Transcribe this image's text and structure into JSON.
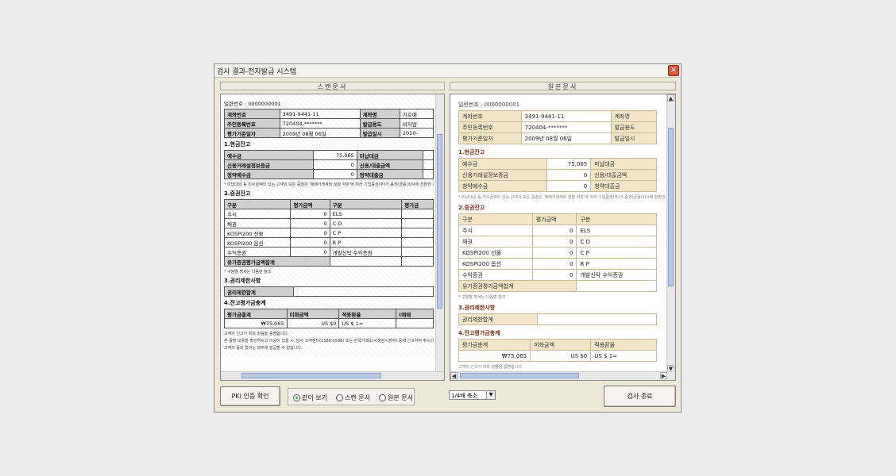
{
  "window": {
    "title": "검사 결과-전자발급 시스템"
  },
  "left_pane": {
    "header": "스캔문서",
    "serial": "일련번호 : 0000000001",
    "info_rows": [
      [
        "계좌번호",
        "3491-9441-11",
        "계좌명",
        "기호예"
      ],
      [
        "주민등록번호",
        "720404-*******",
        "발급용도",
        "비자발"
      ],
      [
        "평가기준일자",
        "2009년 08월 06일",
        "발급일시",
        "2010-"
      ]
    ],
    "sec1": "1.현금잔고",
    "cash_rows": [
      [
        "예수금",
        "75,065",
        "미납대금",
        ""
      ],
      [
        "신용거래설정보증금",
        "0",
        "신용/대출금액",
        ""
      ],
      [
        "청약예수금",
        "0",
        "청약대출금",
        ""
      ]
    ],
    "note1": "* 미납대금 등 미수금액이 있는 고객의 모든 증권은 '매매거래계좌 설정 약관'에 따라 기업증권(주)가 증권(금융)회사에 전환한 경우",
    "sec2": "2.증권잔고",
    "sec_header": [
      "구분",
      "평가금액",
      "구분",
      "평가금"
    ],
    "sec_rows": [
      [
        "주식",
        "0",
        "ELS",
        ""
      ],
      [
        "채권",
        "0",
        "C D",
        ""
      ],
      [
        "KOSPI200 선물",
        "0",
        "C P",
        ""
      ],
      [
        "KOSPI200 옵션",
        "0",
        "R P",
        ""
      ],
      [
        "수익증권",
        "0",
        "개발신탁 수익증권",
        ""
      ]
    ],
    "sec_total": "유가증권평가금액합계",
    "note2": "* 구분별 명세는 다음면 참조",
    "sec3": "3.권리제한사항",
    "rights_label": "권리제한합계",
    "sec4": "4.잔고평가금총계",
    "total_header": [
      "평가금총계",
      "미화금액",
      "적용환율",
      "(매매"
    ],
    "total_row": [
      "₩75,065",
      "US $0",
      "US $ 1=",
      ""
    ],
    "footer1": "고객의 신고가 위와 같음을 증명합니다.",
    "footer2": "본 증명 내용을 확인하시고 이상이 있을 시, 당사 고객센터(1588-1588) 또는 한국거래소(시장감시본부) 등에 신고하여 주시기 바랍니다.",
    "footer3": "고객의 동의 없이는 외부에 발급할 수 없습니다."
  },
  "right_pane": {
    "header": "원본문서",
    "serial": "일련번호 : 0000000001",
    "info_rows": [
      [
        "계좌번호",
        "3491-9441-11",
        "계좌명"
      ],
      [
        "주민등록번호",
        "720404-*******",
        "발급용도"
      ],
      [
        "평가기준일자",
        "2009년 08월 06일",
        "발급일시"
      ]
    ],
    "sec1": "1.현금잔고",
    "cash_rows": [
      [
        "예수금",
        "75,065",
        "미납대금"
      ],
      [
        "신용거래설정보증금",
        "0",
        "신용/대출금액"
      ],
      [
        "청약예수금",
        "0",
        "청약대출금"
      ]
    ],
    "note1": "* 미납대금 등 미수금액이 있는 고객의 모든 증권은 '매매거래계좌 설정 약관'에 따라 기업증권(주)가 증권(금융)회사에 전환한",
    "sec2": "2.증권잔고",
    "sec_header": [
      "구분",
      "평가금액",
      "구분"
    ],
    "sec_rows": [
      [
        "주식",
        "0",
        "ELS"
      ],
      [
        "채권",
        "0",
        "C D"
      ],
      [
        "KOSPI200 선물",
        "0",
        "C P"
      ],
      [
        "KOSPI200 옵션",
        "0",
        "R P"
      ],
      [
        "수익증권",
        "0",
        "개발신탁 수익증권"
      ]
    ],
    "sec_total": "유가증권평가금액합계",
    "note2": "* 구분별 명세는 다음면 참조",
    "sec3": "3.권리제한사항",
    "rights_label": "권리제한합계",
    "sec4": "4.잔고평가금총계",
    "total_header": [
      "평가금총계",
      "미화금액",
      "적용환율"
    ],
    "total_row": [
      "₩75,065",
      "US $0",
      "US $ 1="
    ],
    "footer1": "고객의 신고가 위와 같음을 증명합니다."
  },
  "controls": {
    "pki_button": "PKI 인증 확인",
    "view_options": [
      "같이 보기",
      "스캔 문서",
      "원본 문서"
    ],
    "selected_view": "같이 보기",
    "zoom": "1/4배 축소",
    "end_button": "검사 종료"
  }
}
